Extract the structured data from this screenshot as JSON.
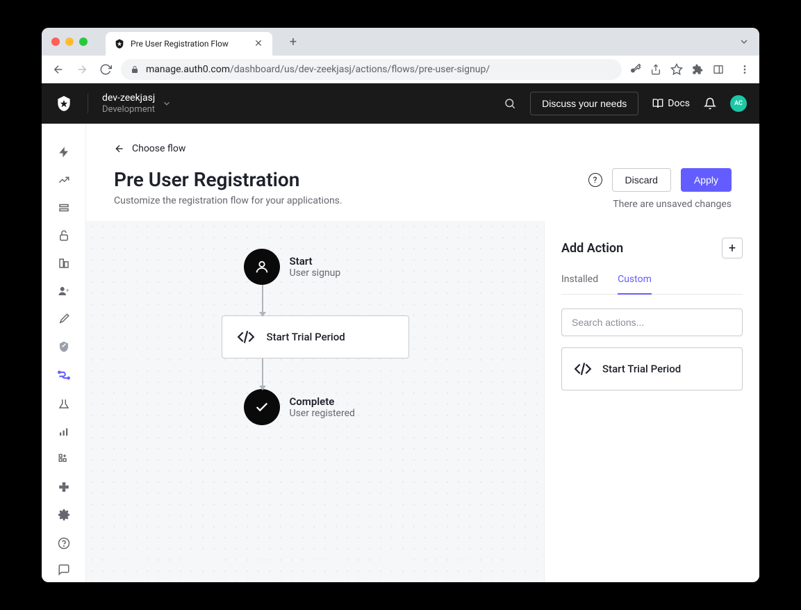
{
  "browser": {
    "tab_title": "Pre User Registration Flow",
    "url_prefix": "manage.auth0.com",
    "url_path": "/dashboard/us/dev-zeekjasj/actions/flows/pre-user-signup/"
  },
  "header": {
    "tenant_name": "dev-zeekjasj",
    "tenant_env": "Development",
    "discuss_label": "Discuss your needs",
    "docs_label": "Docs",
    "avatar_initials": "AC"
  },
  "page": {
    "back_label": "Choose flow",
    "title": "Pre User Registration",
    "subtitle": "Customize the registration flow for your applications.",
    "discard_label": "Discard",
    "apply_label": "Apply",
    "unsaved_message": "There are unsaved changes"
  },
  "flow": {
    "start_title": "Start",
    "start_sub": "User signup",
    "action_label": "Start Trial Period",
    "complete_title": "Complete",
    "complete_sub": "User registered"
  },
  "panel": {
    "title": "Add Action",
    "tab_installed": "Installed",
    "tab_custom": "Custom",
    "search_placeholder": "Search actions...",
    "custom_action": "Start Trial Period"
  }
}
